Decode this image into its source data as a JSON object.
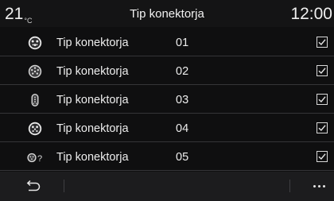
{
  "header": {
    "temperature": "21",
    "temperature_unit": "°C",
    "title": "Tip konektorja",
    "time": "12:00"
  },
  "connectors": [
    {
      "label": "Tip konektorja",
      "number": "01",
      "checked": true,
      "icon": "connector-type-1-icon"
    },
    {
      "label": "Tip konektorja",
      "number": "02",
      "checked": true,
      "icon": "connector-type-2-icon"
    },
    {
      "label": "Tip konektorja",
      "number": "03",
      "checked": true,
      "icon": "connector-type-3-icon"
    },
    {
      "label": "Tip konektorja",
      "number": "04",
      "checked": true,
      "icon": "connector-type-4-icon"
    },
    {
      "label": "Tip konektorja",
      "number": "05",
      "checked": true,
      "icon": "connector-type-unknown-icon"
    }
  ],
  "footer": {
    "back_icon": "back-arrow-icon",
    "more_icon": "more-options-icon"
  }
}
